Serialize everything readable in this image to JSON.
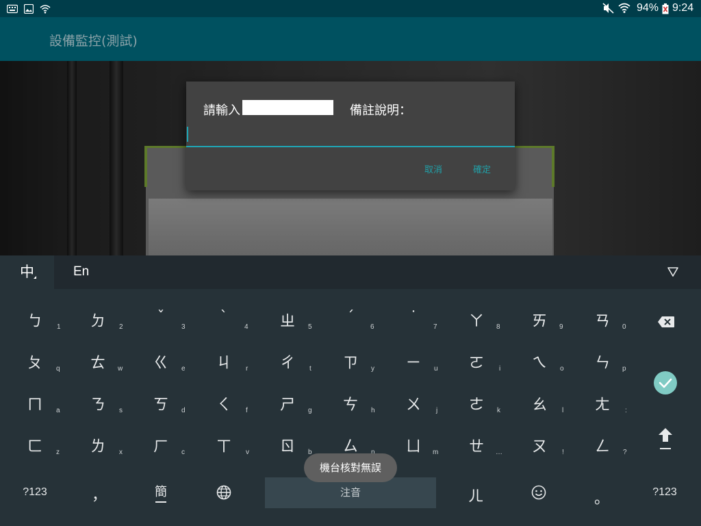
{
  "status": {
    "battery": "94%",
    "time": "9:24"
  },
  "app": {
    "title": "設備監控(測試)"
  },
  "dialog": {
    "prompt_prefix": "請輸入",
    "prompt_suffix": "備註說明：",
    "input_value": "",
    "cancel_label": "取消",
    "ok_label": "確定",
    "accent": "#1fa6b5"
  },
  "keyboard": {
    "lang_zh": "中",
    "lang_en": "En",
    "rows": [
      [
        {
          "m": "ㄅ",
          "s": "1"
        },
        {
          "m": "ㄉ",
          "s": "2"
        },
        {
          "m": "ˇ",
          "s": "3"
        },
        {
          "m": "ˋ",
          "s": "4"
        },
        {
          "m": "ㄓ",
          "s": "5"
        },
        {
          "m": "ˊ",
          "s": "6"
        },
        {
          "m": "˙",
          "s": "7"
        },
        {
          "m": "ㄚ",
          "s": "8"
        },
        {
          "m": "ㄞ",
          "s": "9"
        },
        {
          "m": "ㄢ",
          "s": "0"
        }
      ],
      [
        {
          "m": "ㄆ",
          "s": "q"
        },
        {
          "m": "ㄊ",
          "s": "w"
        },
        {
          "m": "ㄍ",
          "s": "e"
        },
        {
          "m": "ㄐ",
          "s": "r"
        },
        {
          "m": "ㄔ",
          "s": "t"
        },
        {
          "m": "ㄗ",
          "s": "y"
        },
        {
          "m": "ㄧ",
          "s": "u"
        },
        {
          "m": "ㄛ",
          "s": "i"
        },
        {
          "m": "ㄟ",
          "s": "o"
        },
        {
          "m": "ㄣ",
          "s": "p"
        }
      ],
      [
        {
          "m": "ㄇ",
          "s": "a"
        },
        {
          "m": "ㄋ",
          "s": "s"
        },
        {
          "m": "ㄎ",
          "s": "d"
        },
        {
          "m": "ㄑ",
          "s": "f"
        },
        {
          "m": "ㄕ",
          "s": "g"
        },
        {
          "m": "ㄘ",
          "s": "h"
        },
        {
          "m": "ㄨ",
          "s": "j"
        },
        {
          "m": "ㄜ",
          "s": "k"
        },
        {
          "m": "ㄠ",
          "s": "l"
        },
        {
          "m": "ㄤ",
          "s": ":"
        }
      ],
      [
        {
          "m": "ㄈ",
          "s": "z"
        },
        {
          "m": "ㄌ",
          "s": "x"
        },
        {
          "m": "ㄏ",
          "s": "c"
        },
        {
          "m": "ㄒ",
          "s": "v"
        },
        {
          "m": "ㄖ",
          "s": "b"
        },
        {
          "m": "ㄙ",
          "s": "n"
        },
        {
          "m": "ㄩ",
          "s": "m"
        },
        {
          "m": "ㄝ",
          "s": "…"
        },
        {
          "m": "ㄡ",
          "s": "!"
        },
        {
          "m": "ㄥ",
          "s": "?"
        }
      ]
    ],
    "sym_left": "?123",
    "comma": "，",
    "simplified": "簡",
    "space": "注音",
    "er": "ㄦ",
    "period": "。",
    "sym_right": "?123",
    "enter_color": "#80cbc4"
  },
  "toast": {
    "text": "機台核對無誤"
  }
}
